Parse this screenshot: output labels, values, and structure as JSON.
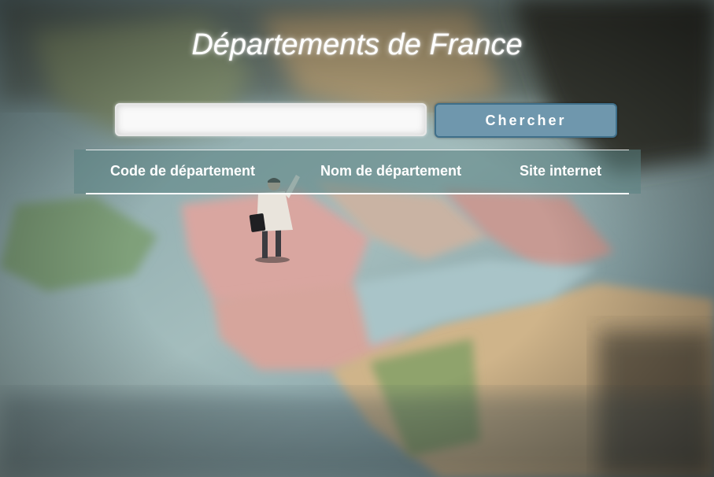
{
  "header": {
    "title": "Départements de France"
  },
  "search": {
    "value": "",
    "placeholder": "",
    "button_label": "Chercher"
  },
  "table": {
    "columns": [
      "Code de département",
      "Nom de département",
      "Site internet"
    ]
  },
  "colors": {
    "button_bg": "#6f97ad",
    "button_border": "#3f6f8a",
    "table_band": "#5a8282"
  }
}
